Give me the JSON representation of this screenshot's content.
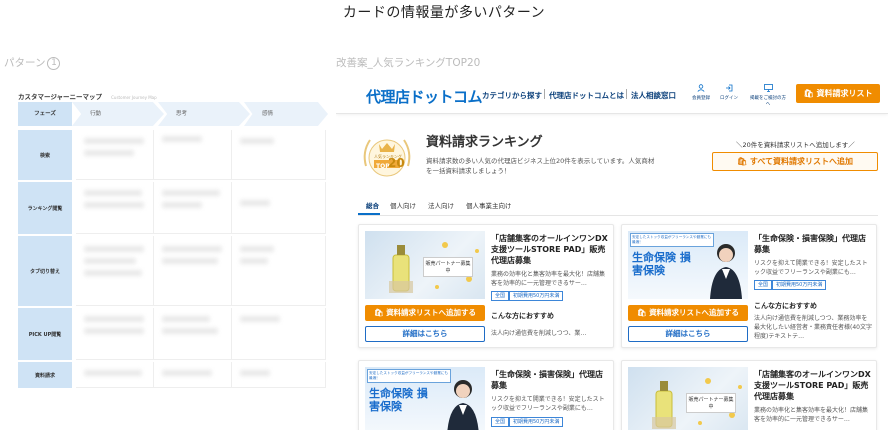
{
  "page_title": "カードの情報量が多いパターン",
  "left_label": "パターン",
  "left_label_num": "1",
  "right_label": "改善案_人気ランキングTOP20",
  "cjm": {
    "title": "カスタマージャーニーマップ",
    "subtitle": "Customer Journey Map",
    "phase_head": "フェーズ",
    "phases": [
      "行動",
      "思考",
      "感情"
    ],
    "rows": [
      "検索",
      "ランキング閲覧",
      "タブ切り替え",
      "PICK UP閲覧",
      "資料請求"
    ]
  },
  "site": {
    "logo": "代理店ドットコム",
    "nav": [
      "カテゴリから探す",
      "代理店ドットコムとは",
      "法人相談窓口"
    ],
    "header_icons": [
      {
        "icon": "person-icon",
        "label": "会員登録"
      },
      {
        "icon": "login-icon",
        "label": "ログイン"
      },
      {
        "icon": "monitor-icon",
        "label": "掲載をご検討の方へ"
      }
    ],
    "request_button": "資料請求リスト",
    "ranking": {
      "badge_top": "人気ランキング",
      "badge_text": "TOP",
      "badge_num": "20",
      "title": "資料請求ランキング",
      "desc": "資料請求数の多い人気の代理店ビジネス上位20件を表示しています。人気商材を一括資料請求しましょう！",
      "add_note": "＼20件を資料請求リストへ追加します／",
      "add_all_button": "すべて資料請求リストへ追加"
    },
    "tabs": [
      "総合",
      "個人向け",
      "法人向け",
      "個人事業主向け"
    ],
    "cards": [
      {
        "title": "「店舗集客のオールインワンDX支援ツールSTORE PAD」販売代理店募集",
        "desc": "業務の効率化と集客効率を最大化！店舗集客を効率的に一元管理できるサー…",
        "tags": [
          "全国",
          "初期費用50万円未満"
        ],
        "sub_title": "こんな方におすすめ",
        "sub_desc": "法人向け通信費を削減しつつ、業…",
        "add_button": "資料請求リストへ追加する",
        "detail_button": "詳細はこちら",
        "image": "store-pad",
        "image_banner": "販売パートナー募集中"
      },
      {
        "title": "「生命保険・損害保険」代理店募集",
        "desc": "リスクを抑えて開業できる！安定したストック収益でフリーランスや副業にも…",
        "tags": [
          "全国",
          "初期費用50万円未満"
        ],
        "sub_title": "こんな方におすすめ",
        "sub_desc": "法人向け通信費を削減しつつ、業務効率を最大化したい経営者・業務責任者様(40文字程度)テキストテ…",
        "add_button": "資料請求リストへ追加する",
        "detail_button": "詳細はこちら",
        "image": "insurance",
        "image_banner": "安定したストック収益がフリーランスや副業にも最適！",
        "image_big": "生命保険 損害保険"
      },
      {
        "title": "「生命保険・損害保険」代理店募集",
        "desc": "リスクを抑えて開業できる！安定したストック収益でフリーランスや副業にも…",
        "tags": [
          "全国",
          "初期費用50万円未満"
        ],
        "image": "insurance",
        "image_banner": "安定したストック収益がフリーランスや副業にも最適！",
        "image_big": "生命保険 損害保険"
      },
      {
        "title": "「店舗集客のオールインワンDX支援ツールSTORE PAD」販売代理店募集",
        "desc": "業務の効率化と集客効率を最大化！店舗集客を効率的に一元管理できるサー…",
        "image": "store-pad",
        "image_banner": "販売パートナー募集中"
      }
    ]
  }
}
